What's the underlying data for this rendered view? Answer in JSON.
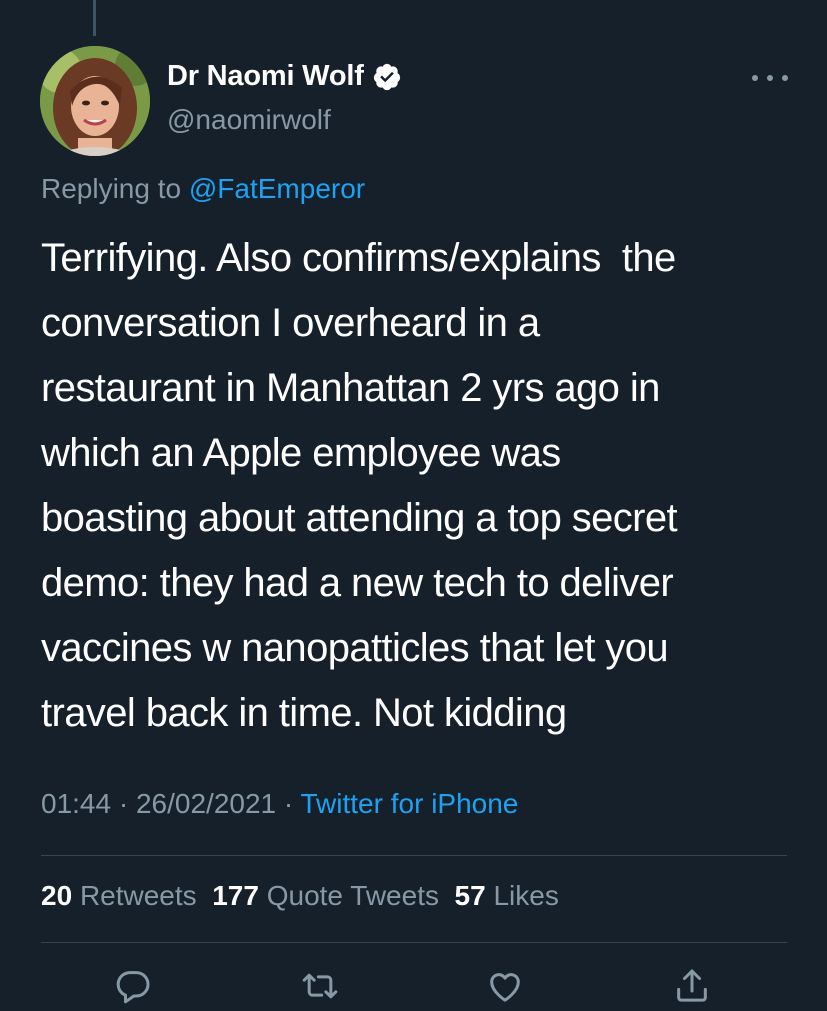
{
  "author": {
    "display_name": "Dr Naomi Wolf",
    "handle": "@naomirwolf",
    "verified": true,
    "avatar_icon": "profile-photo"
  },
  "reply": {
    "prefix": "Replying to",
    "mention": "@FatEmperor"
  },
  "tweet": {
    "lines": [
      "Terrifying. Also confirms/explains  the",
      "conversation I overheard in a",
      "restaurant in Manhattan 2 yrs ago in",
      "which an Apple employee was",
      "boasting about attending a top secret",
      "demo: they had a new tech to deliver",
      "vaccines w nanopatticles that let you",
      "travel back in time. Not kidding"
    ]
  },
  "meta": {
    "time": "01:44",
    "date": "26/02/2021",
    "source": "Twitter for iPhone"
  },
  "stats": {
    "retweets_count": "20",
    "retweets_label": "Retweets",
    "quotes_count": "177",
    "quotes_label": "Quote Tweets",
    "likes_count": "57",
    "likes_label": "Likes"
  },
  "actions": [
    "reply-icon",
    "retweet-icon",
    "like-icon",
    "share-icon"
  ],
  "colors": {
    "background": "#15202b",
    "text": "#ffffff",
    "secondary": "#8899a6",
    "accent": "#1da1f2",
    "divider": "#38444d"
  }
}
